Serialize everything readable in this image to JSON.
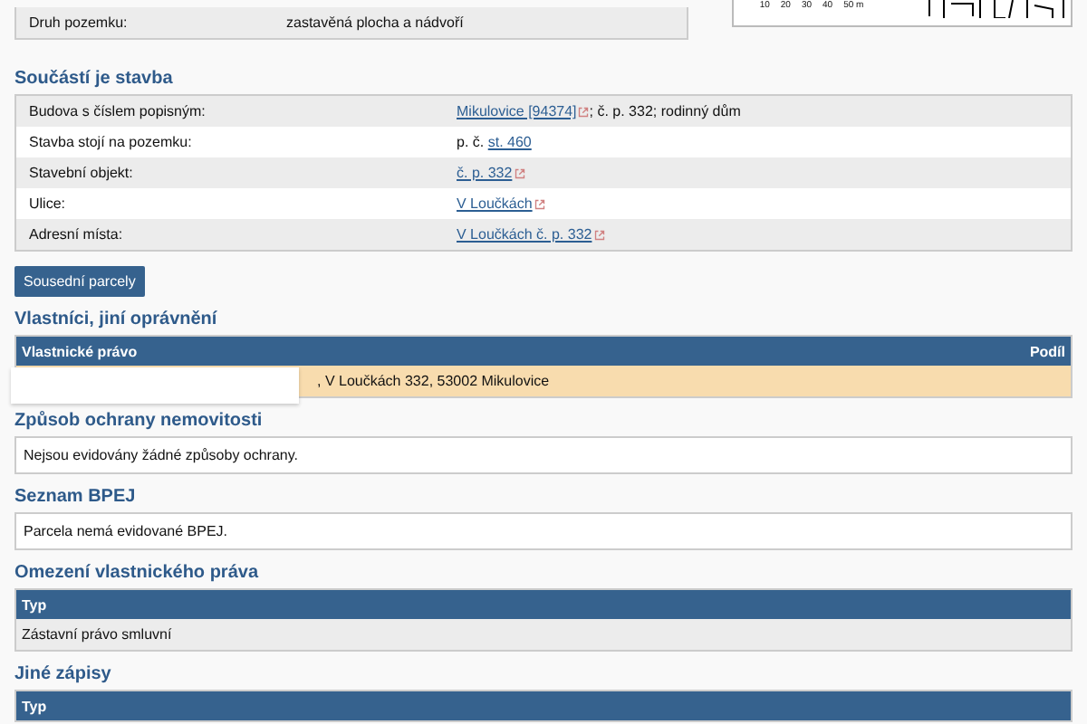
{
  "parcel_table": {
    "rows": [
      {
        "label": "Druh pozemku:",
        "value": [
          {
            "text": "zastavěná plocha a nádvoří",
            "link": false,
            "external": false
          }
        ]
      }
    ]
  },
  "map": {
    "scale_labels": [
      "10",
      "20",
      "30",
      "40",
      "50 m"
    ]
  },
  "building": {
    "heading": "Součástí je stavba",
    "rows": [
      {
        "label": "Budova s číslem popisným:",
        "value": [
          {
            "text": "Mikulovice [94374]",
            "link": true,
            "external": true
          },
          {
            "text": "; č. p. 332; rodinný dům",
            "link": false,
            "external": false
          }
        ]
      },
      {
        "label": "Stavba stojí na pozemku:",
        "value": [
          {
            "text": "p. č.",
            "link": false,
            "external": false
          },
          {
            "text": "st. 460",
            "link": true,
            "external": false
          }
        ]
      },
      {
        "label": "Stavební objekt:",
        "value": [
          {
            "text": "č. p. 332",
            "link": true,
            "external": true
          }
        ]
      },
      {
        "label": "Ulice:",
        "value": [
          {
            "text": "V Loučkách",
            "link": true,
            "external": true
          }
        ]
      },
      {
        "label": "Adresní místa:",
        "value": [
          {
            "text": "V Loučkách č. p. 332",
            "link": true,
            "external": true
          }
        ]
      }
    ]
  },
  "neighbours_button": "Sousední parcely",
  "owners": {
    "heading": "Vlastníci, jiní oprávnění",
    "columns": [
      "Vlastnické právo",
      "Podíl"
    ],
    "rows": [
      {
        "owner": ", V Loučkách 332, 53002 Mikulovice",
        "redacted": true
      }
    ]
  },
  "protection": {
    "heading": "Způsob ochrany nemovitosti",
    "text": "Nejsou evidovány žádné způsoby ochrany."
  },
  "bpej": {
    "heading": "Seznam BPEJ",
    "text": "Parcela nemá evidované BPEJ."
  },
  "restrictions": {
    "heading": "Omezení vlastnického práva",
    "columns": [
      "Typ"
    ],
    "rows": [
      "Zástavní právo smluvní"
    ]
  },
  "other_records": {
    "heading": "Jiné zápisy",
    "columns": [
      "Typ"
    ]
  }
}
